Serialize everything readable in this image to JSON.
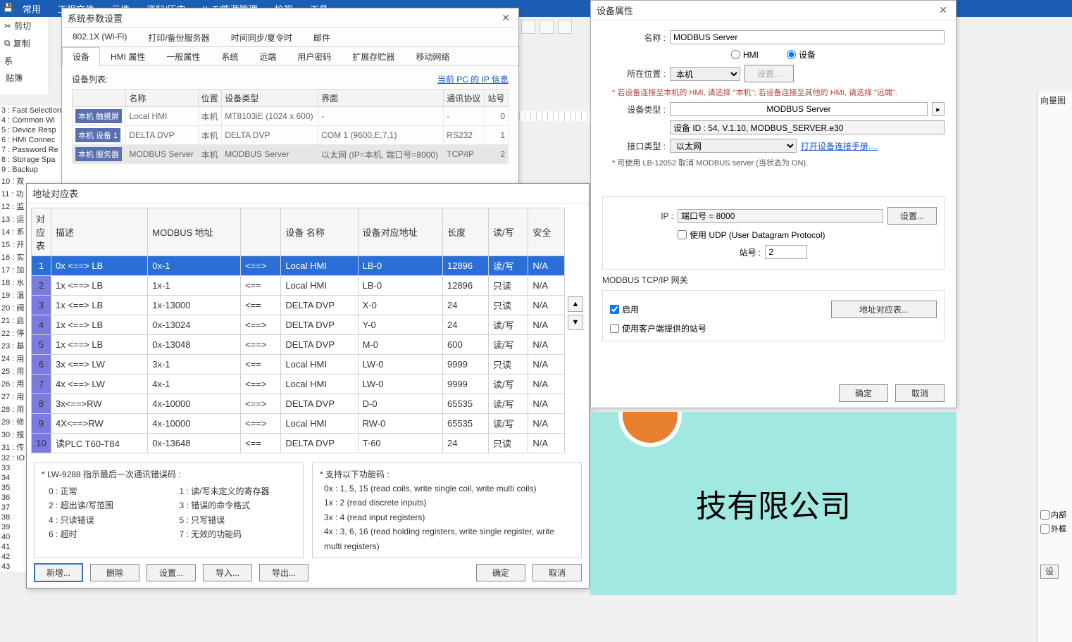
{
  "menubar": [
    "常用",
    "工程文件",
    "元件",
    "资料/历史",
    "IIoT/能源管理",
    "检视",
    "工具"
  ],
  "left_tools": {
    "cut": "剪切",
    "copy": "复制",
    "paste": "贴簿",
    "sys": "系"
  },
  "left_list": [
    "3 : Fast Selection",
    "4 : Common Wi",
    "5 : Device Resp",
    "6 : HMI Connec",
    "7 : Password Re",
    "8 : Storage Spa",
    "9 : Backup",
    "10 : 双",
    "11 : 功",
    "12 : 监",
    "13 : 运",
    "14 : 系",
    "15 : 开",
    "16 : 实",
    "17 : 加",
    "18 : 水",
    "19 : 温",
    "20 : 阀",
    "21 : 启",
    "22 : 停",
    "23 : 基",
    "24 : 用",
    "25 : 用",
    "26 : 用",
    "27 : 用",
    "28 : 用",
    "29 : 修",
    "30 : 报",
    "31 : 传",
    "32 : IO",
    "33",
    "34",
    "35",
    "36",
    "37",
    "38",
    "39",
    "40",
    "41",
    "42",
    "43"
  ],
  "sys_dialog": {
    "title": "系统参数设置",
    "tabs_row1": [
      "802.1X (Wi-Fi)",
      "打印/备份服务器",
      "时间同步/夏令时",
      "邮件"
    ],
    "tabs_row2": [
      "设备",
      "HMI 属性",
      "一般属性",
      "系统",
      "远端",
      "用户密码",
      "扩展存贮器",
      "移动网络"
    ],
    "dev_list_label": "设备列表:",
    "ip_link": "当前 PC 的 IP 信息",
    "cols": [
      "",
      "名称",
      "位置",
      "设备类型",
      "界面",
      "通讯协议",
      "站号"
    ],
    "rows": [
      {
        "tag": "本机 触摸屏",
        "name": "Local HMI",
        "loc": "本机",
        "type": "MT8103iE (1024 x 600)",
        "iface": "-",
        "proto": "-",
        "stn": "0"
      },
      {
        "tag": "本机 设备 1",
        "name": "DELTA DVP",
        "loc": "本机",
        "type": "DELTA DVP",
        "iface": "COM 1 (9600,E,7,1)",
        "proto": "RS232",
        "stn": "1"
      },
      {
        "tag": "本机 服务器",
        "name": "MODBUS Server",
        "loc": "本机",
        "type": "MODBUS Server",
        "iface": "以太网 (IP=本机, 端口号=8000)",
        "proto": "TCP/IP",
        "stn": "2"
      }
    ]
  },
  "addr_dialog": {
    "title": "地址对应表",
    "cols": [
      "对应表",
      "描述",
      "MODBUS 地址",
      "",
      "设备 名称",
      "设备对应地址",
      "长度",
      "读/写",
      "安全"
    ],
    "rows": [
      {
        "n": "1",
        "desc": "0x <==> LB",
        "mb": "0x-1",
        "dir": "<==>",
        "dev": "Local HMI",
        "addr": "LB-0",
        "len": "12896",
        "rw": "读/写",
        "sec": "N/A"
      },
      {
        "n": "2",
        "desc": "1x <==> LB",
        "mb": "1x-1",
        "dir": "<==",
        "dev": "Local HMI",
        "addr": "LB-0",
        "len": "12896",
        "rw": "只读",
        "sec": "N/A"
      },
      {
        "n": "3",
        "desc": "1x <==> LB",
        "mb": "1x-13000",
        "dir": "<==",
        "dev": "DELTA DVP",
        "addr": "X-0",
        "len": "24",
        "rw": "只读",
        "sec": "N/A"
      },
      {
        "n": "4",
        "desc": "1x <==> LB",
        "mb": "0x-13024",
        "dir": "<==>",
        "dev": "DELTA DVP",
        "addr": "Y-0",
        "len": "24",
        "rw": "读/写",
        "sec": "N/A"
      },
      {
        "n": "5",
        "desc": "1x <==> LB",
        "mb": "0x-13048",
        "dir": "<==>",
        "dev": "DELTA DVP",
        "addr": "M-0",
        "len": "600",
        "rw": "读/写",
        "sec": "N/A"
      },
      {
        "n": "6",
        "desc": "3x <==> LW",
        "mb": "3x-1",
        "dir": "<==",
        "dev": "Local HMI",
        "addr": "LW-0",
        "len": "9999",
        "rw": "只读",
        "sec": "N/A"
      },
      {
        "n": "7",
        "desc": "4x <==> LW",
        "mb": "4x-1",
        "dir": "<==>",
        "dev": "Local HMI",
        "addr": "LW-0",
        "len": "9999",
        "rw": "读/写",
        "sec": "N/A"
      },
      {
        "n": "8",
        "desc": "3x<==>RW",
        "mb": "4x-10000",
        "dir": "<==>",
        "dev": "DELTA DVP",
        "addr": "D-0",
        "len": "65535",
        "rw": "读/写",
        "sec": "N/A"
      },
      {
        "n": "9",
        "desc": "4X<==>RW",
        "mb": "4x-10000",
        "dir": "<==>",
        "dev": "Local HMI",
        "addr": "RW-0",
        "len": "65535",
        "rw": "读/写",
        "sec": "N/A"
      },
      {
        "n": "10",
        "desc": "读PLC  T60-T84",
        "mb": "0x-13648",
        "dir": "<==",
        "dev": "DELTA DVP",
        "addr": "T-60",
        "len": "24",
        "rw": "只读",
        "sec": "N/A"
      }
    ],
    "info_left_title": "* LW-9288 指示最后一次通讯错误码 :",
    "info_left": [
      "0 : 正常",
      "1 : 读/写未定义的寄存器",
      "2 : 超出读/写范围",
      "3 : 错误的命令格式",
      "4 : 只读错误",
      "5 : 只写错误",
      "6 : 超时",
      "7 : 无效的功能码"
    ],
    "info_right_title": "* 支持以下功能码 :",
    "info_right": [
      "0x : 1, 5, 15 (read coils, write single coil, write multi coils)",
      "1x : 2 (read discrete inputs)",
      "3x : 4 (read input registers)",
      "4x : 3, 6, 16 (read holding registers, write single register, write multi registers)"
    ],
    "btns": {
      "new": "新增...",
      "del": "删除",
      "set": "设置...",
      "imp": "导入...",
      "exp": "导出...",
      "ok": "确定",
      "cancel": "取消"
    }
  },
  "dev_dialog": {
    "title": "设备属性",
    "name_lbl": "名称 :",
    "name_val": "MODBUS Server",
    "radio_hmi": "HMI",
    "radio_dev": "设备",
    "loc_lbl": "所在位置 :",
    "loc_val": "本机",
    "loc_btn": "设置...",
    "loc_note": "* 若设备连接至本机的 HMI, 请选择 \"本机\"; 若设备连接至其他的 HMI, 请选择 \"远端\".",
    "type_lbl": "设备类型 :",
    "type_val": "MODBUS Server",
    "type_id": "设备 ID : 54, V.1.10, MODBUS_SERVER.e30",
    "if_lbl": "接口类型 :",
    "if_val": "以太网",
    "if_link": "打开设备连接手册....",
    "cancel_note": "* 可使用 LB-12052 取消 MODBUS server (当状态为 ON).",
    "ip_lbl": "IP :",
    "ip_val": "端口号 = 8000",
    "ip_btn": "设置...",
    "udp_chk": "使用 UDP (User Datagram Protocol)",
    "stn_lbl": "站号 :",
    "stn_val": "2",
    "gw_title": "MODBUS TCP/IP 网关",
    "gw_en": "启用",
    "gw_client": "使用客户端提供的站号",
    "gw_btn": "地址对应表...",
    "ok": "确定",
    "cancel": "取消"
  },
  "canvas_text": "技有限公司",
  "right_panel": {
    "hdr": "向量图",
    "chk1": "内部",
    "chk2": "外框",
    "btn": "设"
  }
}
